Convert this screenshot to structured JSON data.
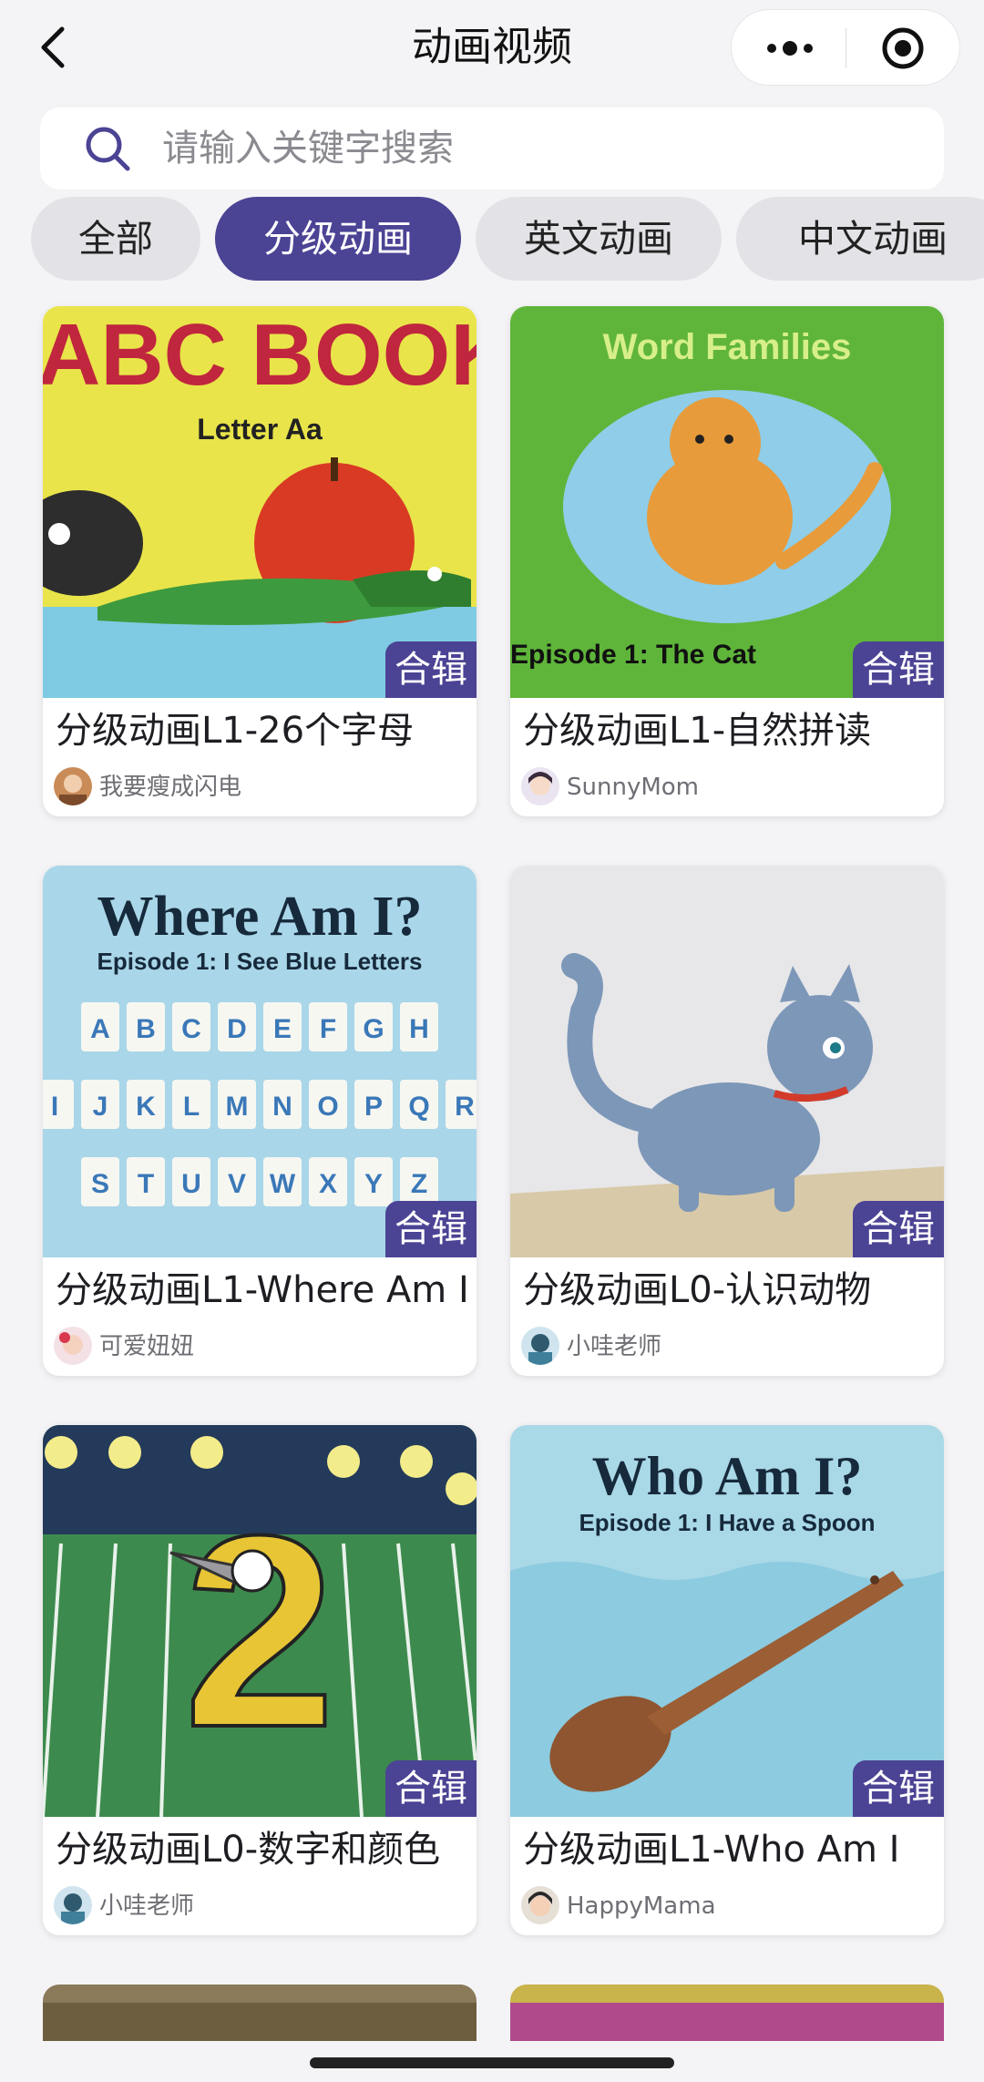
{
  "nav": {
    "title": "动画视频"
  },
  "search": {
    "placeholder": "请输入关键字搜索"
  },
  "tabs": [
    {
      "label": "全部",
      "active": false
    },
    {
      "label": "分级动画",
      "active": true
    },
    {
      "label": "英文动画",
      "active": false
    },
    {
      "label": "中文动画",
      "active": false
    }
  ],
  "cards": [
    {
      "title": "分级动画L1-26个字母",
      "author": "我要瘦成闪电",
      "badge": "合辑",
      "thumb_text": [
        "ABC BOOK",
        "Letter Aa"
      ]
    },
    {
      "title": "分级动画L1-自然拼读",
      "author": "SunnyMom",
      "badge": "合辑",
      "thumb_text": [
        "Word Families",
        "Episode 1: The Cat"
      ]
    },
    {
      "title": "分级动画L1-Where Am I",
      "author": "可爱妞妞",
      "badge": "合辑",
      "thumb_text": [
        "Where Am I?",
        "Episode 1: I See Blue Letters"
      ],
      "letters": [
        "A",
        "B",
        "C",
        "D",
        "E",
        "F",
        "G",
        "H",
        "I",
        "J",
        "K",
        "L",
        "M",
        "N",
        "O",
        "P",
        "Q",
        "R",
        "S",
        "T",
        "U",
        "V",
        "W",
        "X",
        "Y",
        "Z"
      ]
    },
    {
      "title": "分级动画L0-认识动物",
      "author": "小哇老师",
      "badge": "合辑",
      "thumb_text": []
    },
    {
      "title": "分级动画L0-数字和颜色",
      "author": "小哇老师",
      "badge": "合辑",
      "thumb_text": [
        "2"
      ]
    },
    {
      "title": "分级动画L1-Who Am I",
      "author": "HappyMama",
      "badge": "合辑",
      "thumb_text": [
        "Who Am I?",
        "Episode 1: I Have a Spoon"
      ]
    }
  ],
  "colors": {
    "accent": "#4b4394",
    "background": "#f4f4f6"
  }
}
